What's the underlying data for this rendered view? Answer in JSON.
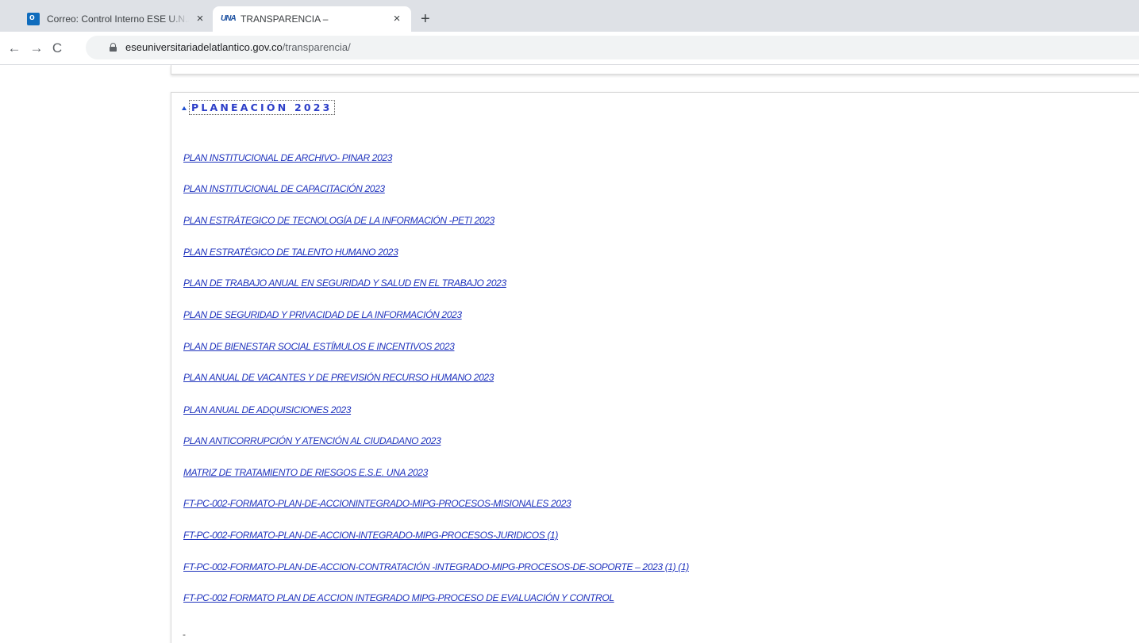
{
  "browser": {
    "tabs": [
      {
        "title": "Correo: Control Interno ESE U.N.A",
        "favicon": "outlook-icon",
        "close": "×"
      },
      {
        "title": "TRANSPARENCIA –",
        "favicon": "una-logo-icon",
        "favicon_text": "UNA",
        "close": "×"
      }
    ],
    "new_tab": "+",
    "nav": {
      "back": "←",
      "forward": "→",
      "reload": "C"
    },
    "url_host": "eseuniversitariadelatlantico.gov.co",
    "url_path": "/transparencia/"
  },
  "section": {
    "title": "PLANEACIÓN 2023",
    "links": [
      "PLAN INSTITUCIONAL DE ARCHIVO- PINAR 2023",
      "PLAN INSTITUCIONAL DE CAPACITACIÓN 2023",
      "PLAN ESTRÁTEGICO DE TECNOLOGÍA DE LA INFORMACIÓN -PETI 2023",
      "PLAN ESTRATÉGICO DE TALENTO HUMANO 2023",
      "PLAN DE TRABAJO ANUAL EN SEGURIDAD Y SALUD EN EL TRABAJO 2023",
      "PLAN DE SEGURIDAD Y PRIVACIDAD DE LA INFORMACIÓN 2023",
      "PLAN DE BIENESTAR SOCIAL ESTÍMULOS E INCENTIVOS 2023",
      "PLAN ANUAL DE VACANTES Y DE PREVISIÓN RECURSO HUMANO 2023",
      "PLAN ANUAL DE ADQUISICIONES 2023",
      "PLAN ANTICORRUPCIÓN Y ATENCIÓN AL CIUDADANO 2023",
      "MATRIZ DE TRATAMIENTO DE RIESGOS E.S.E. UNA 2023",
      "FT-PC-002-FORMATO-PLAN-DE-ACCIONINTEGRADO-MIPG-PROCESOS-MISIONALES 2023",
      "FT-PC-002-FORMATO-PLAN-DE-ACCION-INTEGRADO-MIPG-PROCESOS-JURIDICOS (1)",
      "FT-PC-002-FORMATO-PLAN-DE-ACCION-CONTRATACIÓN -INTEGRADO-MIPG-PROCESOS-DE-SOPORTE – 2023 (1) (1)",
      "FT-PC-002 FORMATO PLAN DE ACCION INTEGRADO MIPG-PROCESO DE EVALUACIÓN Y CONTROL"
    ],
    "trailing_text": "-"
  }
}
